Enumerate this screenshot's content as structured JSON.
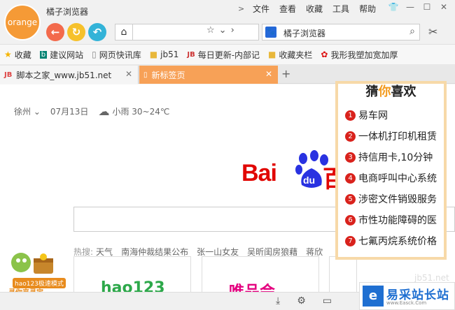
{
  "titlebar": {
    "logo_text": "orange",
    "app_title": "橘子浏览器",
    "menus": [
      "文件",
      "查看",
      "收藏",
      "工具",
      "帮助"
    ]
  },
  "navbar": {
    "search_engine_icon": "baidu-paw-icon",
    "search_text": "橘子浏览器"
  },
  "bookmarks": [
    {
      "label": "收藏",
      "icon": "star-icon"
    },
    {
      "label": "建议网站",
      "icon": "bing-icon"
    },
    {
      "label": "网页快讯库",
      "icon": "page-icon"
    },
    {
      "label": "jb51",
      "icon": "folder-icon"
    },
    {
      "label": "每日更新-内部记",
      "icon": "jb-icon"
    },
    {
      "label": "收藏夹栏",
      "icon": "folder-icon"
    },
    {
      "label": "我形我塑加宽加厚",
      "icon": "huawei-icon"
    }
  ],
  "tabs": [
    {
      "label": "脚本之家_www.jb51.net",
      "active": false
    },
    {
      "label": "新标签页",
      "active": true
    }
  ],
  "content": {
    "city": "徐州",
    "date": "07月13日",
    "weather": "小雨 30~24℃",
    "baidu_text": "Bai",
    "paw_text": "du",
    "baidu_tail": "百",
    "hot_label": "热搜:",
    "hot_words": [
      "天气",
      "南海仲裁结果公布",
      "张一山女友",
      "吴昕闺房狼藉",
      "蒋欣"
    ],
    "card1_logo": "hao123",
    "card2_logo": "唯品会",
    "mascot_badge": "hao123极速模式",
    "mascot_sub": "寻你来寻宝"
  },
  "ad": {
    "title_pre": "猜",
    "title_hl": "你",
    "title_post": "喜欢",
    "items": [
      {
        "num": "1",
        "text": "易车网"
      },
      {
        "num": "2",
        "text": "一体机打印机租赁"
      },
      {
        "num": "3",
        "text": "持信用卡,10分钟"
      },
      {
        "num": "4",
        "text": "电商呼叫中心系统"
      },
      {
        "num": "5",
        "text": "涉密文件销毁服务"
      },
      {
        "num": "6",
        "text": "市性功能障碍的医"
      },
      {
        "num": "7",
        "text": "七氟丙烷系统价格"
      }
    ]
  },
  "watermark": {
    "logo": "e",
    "text": "易采站长站",
    "sub": "www.Easck.Com",
    "overlay": "jb51.net"
  },
  "colors": {
    "orange": "#f59a36",
    "tab_active": "#f7a157",
    "baidu_red": "#e10602",
    "baidu_blue": "#2932e1"
  }
}
